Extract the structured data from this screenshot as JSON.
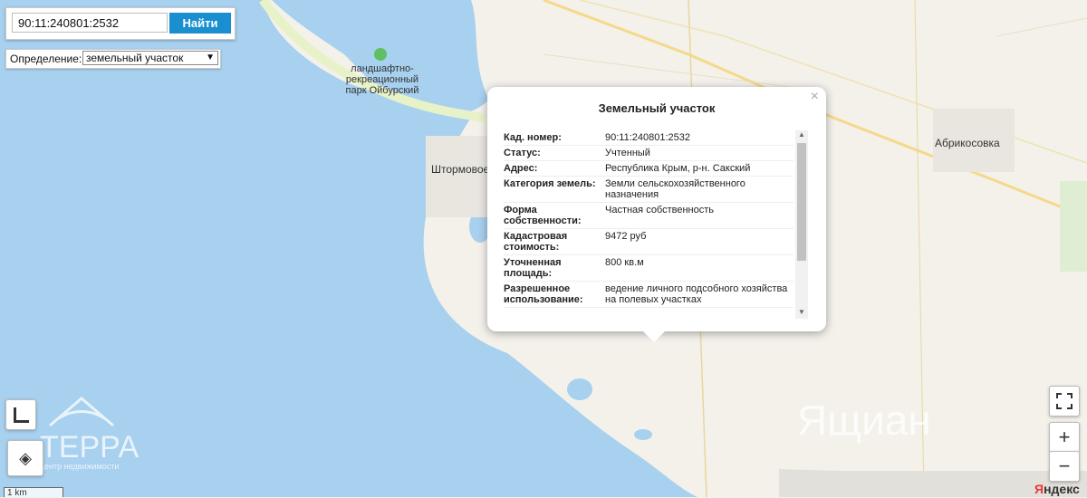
{
  "search": {
    "value": "90:11:240801:2532",
    "button_label": "Найти"
  },
  "definition": {
    "label": "Определение:",
    "selected": "земельный участок"
  },
  "popup": {
    "title": "Земельный участок",
    "rows": [
      {
        "key": "Кад. номер:",
        "value": "90:11:240801:2532"
      },
      {
        "key": "Статус:",
        "value": "Учтенный"
      },
      {
        "key": "Адрес:",
        "value": "Республика Крым, р-н. Сакский"
      },
      {
        "key": "Категория земель:",
        "value": "Земли сельскохозяйственного назначения"
      },
      {
        "key": "Форма собственности:",
        "value": "Частная собственность"
      },
      {
        "key": "Кадастровая стоимость:",
        "value": "9472 руб"
      },
      {
        "key": "Уточненная площадь:",
        "value": "800 кв.м"
      },
      {
        "key": "Разрешенное использование:",
        "value": "ведение личного подсобного хозяйства на полевых участках"
      }
    ]
  },
  "map_labels": {
    "park": "ландшафтно-рекреационный парк Ойбурский",
    "village1": "Штормовое",
    "village2": "Абрикосовка",
    "district": "Ящиан"
  },
  "watermark": {
    "brand": "ТЕРРА",
    "tagline": "центр недвижимости"
  },
  "controls": {
    "zoom_in": "+",
    "zoom_out": "−"
  },
  "scale_label": "1 km",
  "attribution": {
    "prefix": "Я",
    "rest": "ндекс"
  },
  "colors": {
    "sea": "#a8d0ef",
    "land": "#f3f1ea",
    "road": "#f5d98a",
    "accent": "#1a8fd0"
  }
}
